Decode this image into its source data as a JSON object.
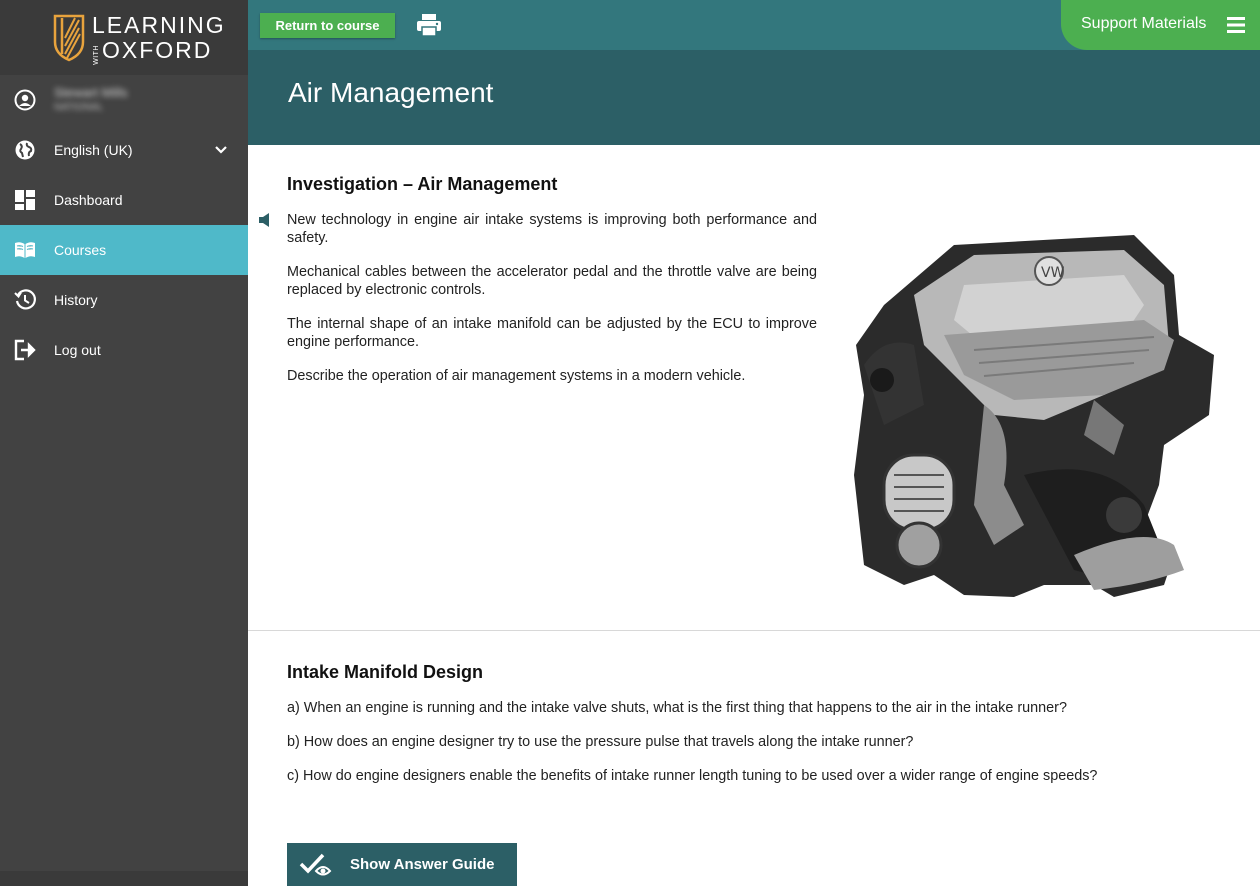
{
  "brand": {
    "top": "LEARNING",
    "with": "WITH",
    "bottom": "OXFORD",
    "accent": "#e8a33d"
  },
  "sidebar": {
    "user": {
      "name": "Stewart Mills",
      "subtitle": "NATIONAL"
    },
    "language": {
      "label": "English (UK)",
      "icon": "globe-icon"
    },
    "items": [
      {
        "label": "Dashboard",
        "icon": "dashboard-icon",
        "active": false
      },
      {
        "label": "Courses",
        "icon": "book-icon",
        "active": true
      },
      {
        "label": "History",
        "icon": "history-icon",
        "active": false
      },
      {
        "label": "Log out",
        "icon": "logout-icon",
        "active": false
      }
    ]
  },
  "topbar": {
    "return_label": "Return to course",
    "print_icon": "print-icon",
    "support_label": "Support Materials",
    "menu_icon": "hamburger-icon"
  },
  "page": {
    "title": "Air Management"
  },
  "investigation": {
    "title": "Investigation – Air Management",
    "paragraphs": [
      "New technology in engine air intake systems is improving both performance and safety.",
      "Mechanical cables between the accelerator pedal and the throttle valve are being replaced by electronic controls.",
      "The internal shape of an intake manifold can be adjusted by the ECU to improve engine performance.",
      "Describe the operation of air management systems in a modern vehicle."
    ],
    "image_alt": "engine-image"
  },
  "intake": {
    "title": "Intake Manifold Design",
    "questions": [
      "a) When an engine is running and the intake valve shuts, what is the first thing that happens to the air in the intake runner?",
      "b) How does an engine designer try to use the pressure pulse that travels along the intake runner?",
      "c) How do engine designers enable the benefits of intake runner length tuning to be used over a wider range of engine speeds?"
    ]
  },
  "answer_button": {
    "label": "Show Answer Guide"
  },
  "colors": {
    "sidebar": "#424242",
    "active": "#4fb9c9",
    "topbar": "#33777d",
    "band": "#2c5f66",
    "green": "#4caf50"
  }
}
